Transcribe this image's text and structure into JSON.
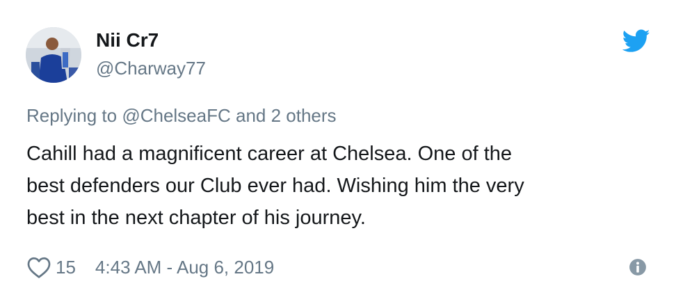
{
  "author": {
    "name": "Nii Cr7",
    "handle": "@Charway77",
    "avatar": "avatar-image"
  },
  "reply": {
    "prefix": "Replying to",
    "mention": "@ChelseaFC",
    "suffix": "and 2 others"
  },
  "body": {
    "lines": [
      "Cahill had a magnificent career at Chelsea. One of the",
      "best defenders our Club ever had. Wishing him the very",
      "best in the next chapter of his journey."
    ]
  },
  "footer": {
    "likes": "15",
    "timestamp": "4:43 AM - Aug 6, 2019"
  },
  "icons": {
    "brand": "twitter-bird-icon",
    "like": "heart-icon",
    "info": "info-icon"
  },
  "colors": {
    "twitter_blue": "#1da1f2",
    "text_primary": "#14171a",
    "text_secondary": "#657786",
    "background": "#ffffff"
  }
}
